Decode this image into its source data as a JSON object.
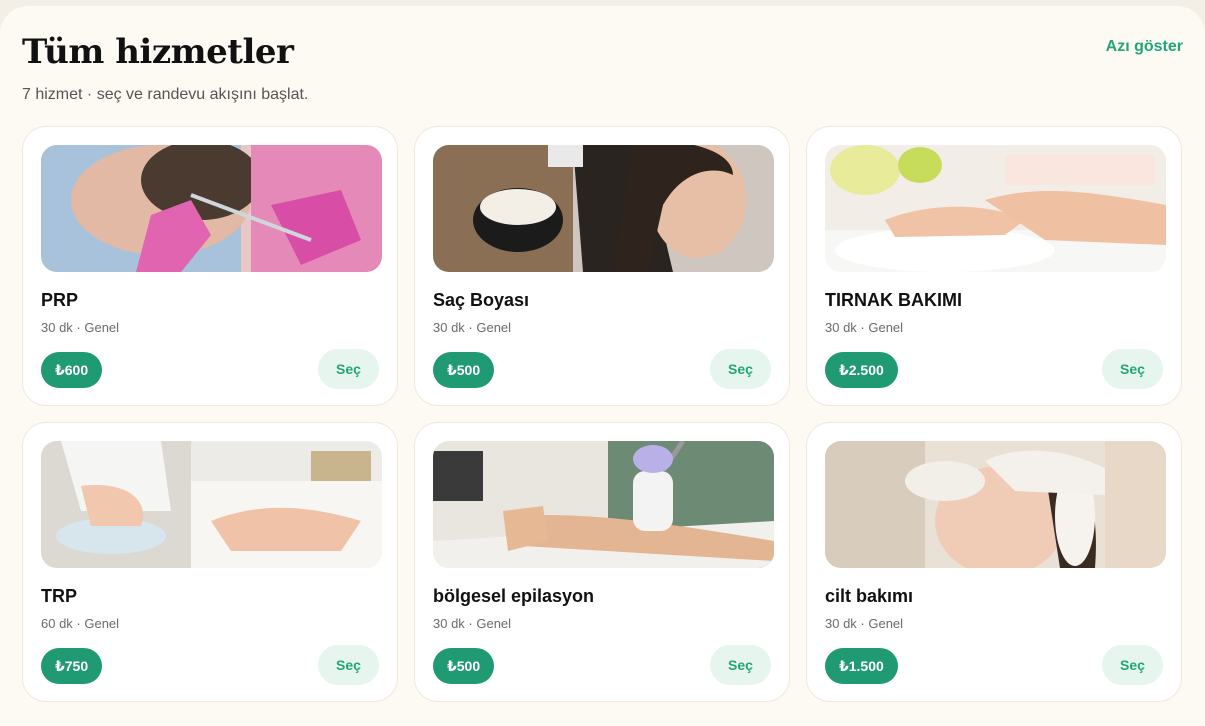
{
  "header": {
    "title": "Tüm hizmetler",
    "subtitle": "7 hizmet · seç ve randevu akışını başlat.",
    "toggle_label": "Azı göster"
  },
  "services": [
    {
      "name": "PRP",
      "meta": "30 dk · Genel",
      "price": "₺600",
      "select_label": "Seç"
    },
    {
      "name": "Saç Boyası",
      "meta": "30 dk · Genel",
      "price": "₺500",
      "select_label": "Seç"
    },
    {
      "name": "TIRNAK BAKIMI",
      "meta": "30 dk · Genel",
      "price": "₺2.500",
      "select_label": "Seç"
    },
    {
      "name": "TRP",
      "meta": "60 dk · Genel",
      "price": "₺750",
      "select_label": "Seç"
    },
    {
      "name": "bölgesel epilasyon",
      "meta": "30 dk · Genel",
      "price": "₺500",
      "select_label": "Seç"
    },
    {
      "name": "cilt bakımı",
      "meta": "30 dk · Genel",
      "price": "₺1.500",
      "select_label": "Seç"
    }
  ],
  "colors": {
    "accent": "#1f9a72",
    "accent_light": "#e6f5ee",
    "background": "#fdfaf3"
  }
}
